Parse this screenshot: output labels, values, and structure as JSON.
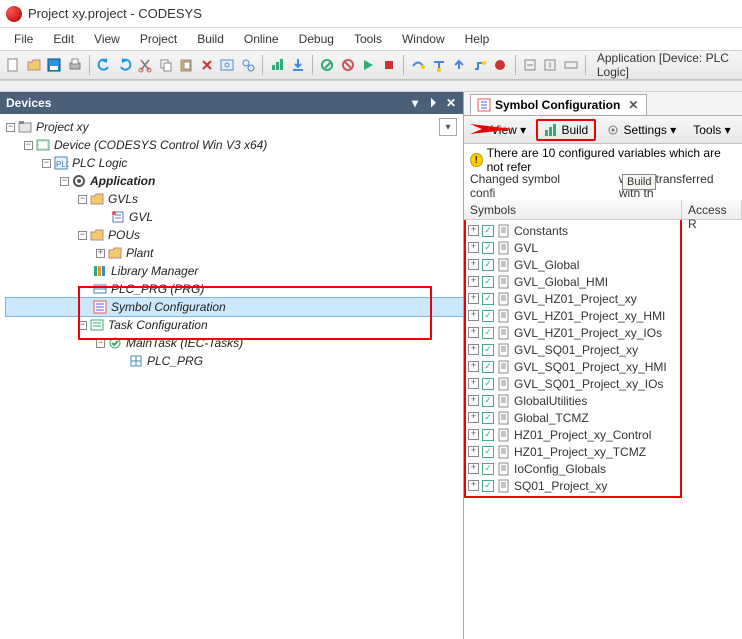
{
  "title": "Project xy.project - CODESYS",
  "menus": [
    "File",
    "Edit",
    "View",
    "Project",
    "Build",
    "Online",
    "Debug",
    "Tools",
    "Window",
    "Help"
  ],
  "toolbar_context": "Application [Device: PLC Logic]",
  "devices_pane_title": "Devices",
  "tree": [
    {
      "d": 0,
      "exp": "-",
      "icon": "project",
      "label": "Project xy",
      "bold": false
    },
    {
      "d": 1,
      "exp": "-",
      "icon": "device",
      "label": "Device (CODESYS Control Win V3 x64)",
      "bold": false
    },
    {
      "d": 2,
      "exp": "-",
      "icon": "plc",
      "label": "PLC Logic",
      "bold": false
    },
    {
      "d": 3,
      "exp": "-",
      "icon": "app",
      "label": "Application",
      "bold": true
    },
    {
      "d": 4,
      "exp": "-",
      "icon": "folder",
      "label": "GVLs",
      "bold": false
    },
    {
      "d": 5,
      "exp": "",
      "icon": "gvl",
      "label": "GVL",
      "bold": false
    },
    {
      "d": 4,
      "exp": "-",
      "icon": "folder",
      "label": "POUs",
      "bold": false
    },
    {
      "d": 5,
      "exp": "+",
      "icon": "folder",
      "label": "Plant",
      "bold": false
    },
    {
      "d": 4,
      "exp": "",
      "icon": "lib",
      "label": "Library Manager",
      "bold": false
    },
    {
      "d": 4,
      "exp": "",
      "icon": "pou",
      "label": "PLC_PRG (PRG)",
      "bold": false
    },
    {
      "d": 4,
      "exp": "",
      "icon": "symcfg",
      "label": "Symbol Configuration",
      "bold": false,
      "selected": true
    },
    {
      "d": 4,
      "exp": "-",
      "icon": "taskcfg",
      "label": "Task Configuration",
      "bold": false
    },
    {
      "d": 5,
      "exp": "-",
      "icon": "task",
      "label": "MainTask (IEC-Tasks)",
      "bold": false
    },
    {
      "d": 6,
      "exp": "",
      "icon": "prgref",
      "label": "PLC_PRG",
      "bold": false
    }
  ],
  "right_tab_label": "Symbol Configuration",
  "right_toolbar": {
    "view_label": "View",
    "build_label": "Build",
    "settings_label": "Settings",
    "tools_label": "Tools"
  },
  "warning_text": "There are 10 configured variables which are not refer",
  "changed_text_before": "Changed symbol confi",
  "changed_text_after": "will be transferred with th",
  "tooltip_text": "Build",
  "sym_headers": [
    "Symbols",
    "Access R"
  ],
  "symbols": [
    "Constants",
    "GVL",
    "GVL_Global",
    "GVL_Global_HMI",
    "GVL_HZ01_Project_xy",
    "GVL_HZ01_Project_xy_HMI",
    "GVL_HZ01_Project_xy_IOs",
    "GVL_SQ01_Project_xy",
    "GVL_SQ01_Project_xy_HMI",
    "GVL_SQ01_Project_xy_IOs",
    "GlobalUtilities",
    "Global_TCMZ",
    "HZ01_Project_xy_Control",
    "HZ01_Project_xy_TCMZ",
    "IoConfig_Globals",
    "SQ01_Project_xy"
  ]
}
